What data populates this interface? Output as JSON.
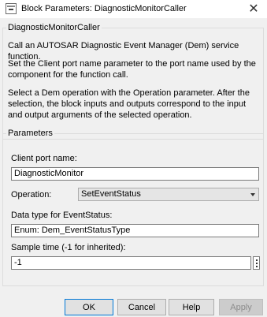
{
  "window": {
    "title": "Block Parameters: DiagnosticMonitorCaller",
    "close_glyph": "✕"
  },
  "description": {
    "legend": "DiagnosticMonitorCaller",
    "para1": "Call an AUTOSAR Diagnostic Event Manager (Dem) service function.",
    "para2": "Set the Client port name parameter to the port name used by the component for the function call.",
    "para3": "Select a Dem operation with the Operation parameter.  After the selection, the block inputs and outputs correspond to the input and output arguments of the selected operation."
  },
  "parameters": {
    "legend": "Parameters",
    "client_port_label": "Client port name:",
    "client_port_value": "DiagnosticMonitor",
    "operation_label": "Operation:",
    "operation_value": "SetEventStatus",
    "data_type_label": "Data type for EventStatus:",
    "data_type_value": "Enum: Dem_EventStatusType",
    "sample_time_label": "Sample time (-1 for inherited):",
    "sample_time_value": "-1"
  },
  "buttons": {
    "ok": "OK",
    "cancel": "Cancel",
    "help": "Help",
    "apply": "Apply"
  }
}
